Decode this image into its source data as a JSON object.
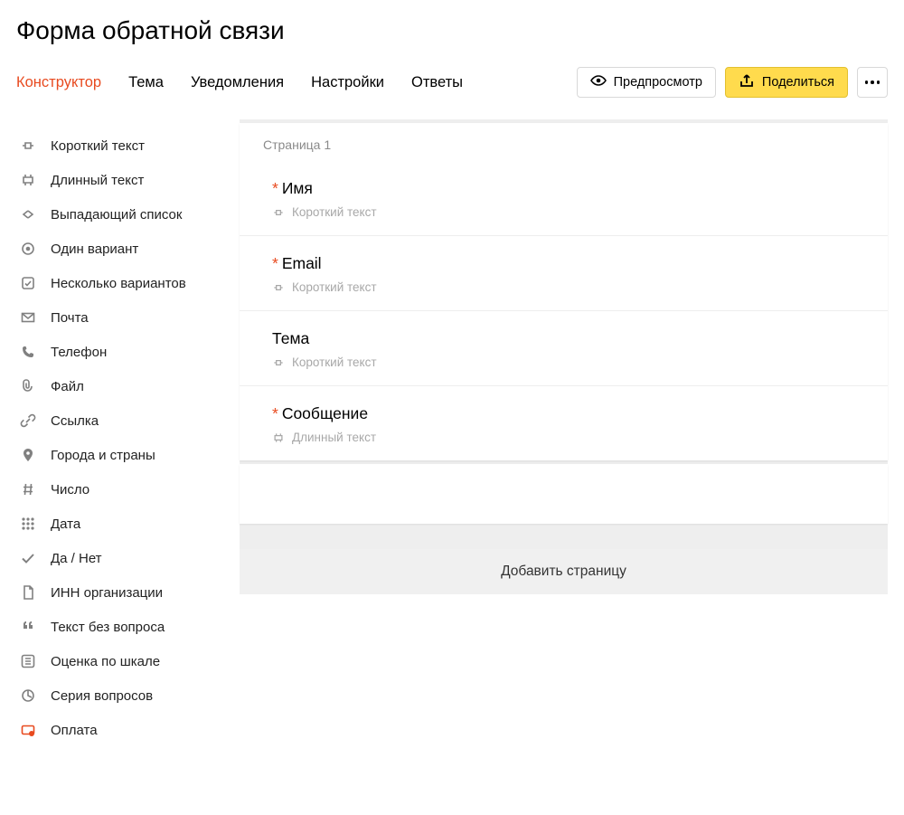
{
  "title": "Форма обратной связи",
  "tabs": [
    {
      "label": "Конструктор",
      "active": true
    },
    {
      "label": "Тема"
    },
    {
      "label": "Уведомления"
    },
    {
      "label": "Настройки"
    },
    {
      "label": "Ответы"
    }
  ],
  "actions": {
    "preview": "Предпросмотр",
    "share": "Поделиться"
  },
  "sidebar": [
    {
      "label": "Короткий текст",
      "icon": "short-text"
    },
    {
      "label": "Длинный текст",
      "icon": "long-text"
    },
    {
      "label": "Выпадающий список",
      "icon": "dropdown"
    },
    {
      "label": "Один вариант",
      "icon": "radio"
    },
    {
      "label": "Несколько вариантов",
      "icon": "checkbox"
    },
    {
      "label": "Почта",
      "icon": "mail"
    },
    {
      "label": "Телефон",
      "icon": "phone"
    },
    {
      "label": "Файл",
      "icon": "file"
    },
    {
      "label": "Ссылка",
      "icon": "link"
    },
    {
      "label": "Города и страны",
      "icon": "geo"
    },
    {
      "label": "Число",
      "icon": "hash"
    },
    {
      "label": "Дата",
      "icon": "date"
    },
    {
      "label": "Да / Нет",
      "icon": "check"
    },
    {
      "label": "ИНН организации",
      "icon": "doc"
    },
    {
      "label": "Текст без вопроса",
      "icon": "quote"
    },
    {
      "label": "Оценка по шкале",
      "icon": "scale"
    },
    {
      "label": "Серия вопросов",
      "icon": "series"
    },
    {
      "label": "Оплата",
      "icon": "payment",
      "red": true
    }
  ],
  "builder": {
    "page_label": "Страница 1",
    "questions": [
      {
        "required": true,
        "title": "Имя",
        "type_label": "Короткий текст",
        "type_icon": "short-text"
      },
      {
        "required": true,
        "title": "Email",
        "type_label": "Короткий текст",
        "type_icon": "short-text"
      },
      {
        "required": false,
        "title": "Тема",
        "type_label": "Короткий текст",
        "type_icon": "short-text"
      },
      {
        "required": true,
        "title": "Сообщение",
        "type_label": "Длинный текст",
        "type_icon": "long-text"
      }
    ],
    "add_page": "Добавить страницу"
  }
}
